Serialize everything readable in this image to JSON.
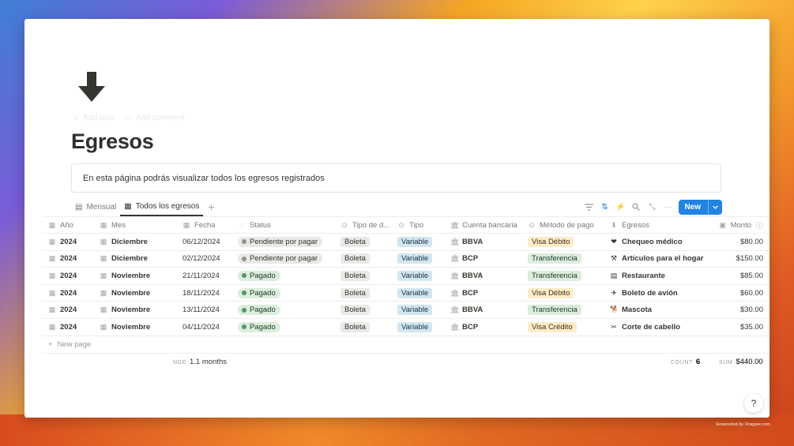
{
  "page": {
    "title": "Egresos",
    "ghost_add_icon": "Add icon",
    "ghost_add_comment": "Add comment",
    "callout": "En esta página podrás visualizar todos los egresos registrados"
  },
  "views": {
    "tabs": [
      {
        "label": "Mensual",
        "icon": "calendar-icon",
        "active": false
      },
      {
        "label": "Todos los egresos",
        "icon": "table-icon",
        "active": true
      }
    ],
    "new_label": "New"
  },
  "columns": [
    {
      "label": "Año",
      "icon": "calendar-icon"
    },
    {
      "label": "Mes",
      "icon": "calendar-icon"
    },
    {
      "label": "Fecha",
      "icon": "calendar-icon"
    },
    {
      "label": "Status",
      "icon": "status-icon"
    },
    {
      "label": "Tipo de d...",
      "icon": "select-icon"
    },
    {
      "label": "Tipo",
      "icon": "select-icon"
    },
    {
      "label": "Cuenta bancaria",
      "icon": "bank-icon"
    },
    {
      "label": "Método de pago",
      "icon": "select-icon"
    },
    {
      "label": "Egresos",
      "icon": "arrow-down-icon"
    },
    {
      "label": "Monto",
      "icon": "money-icon"
    }
  ],
  "rows": [
    {
      "year": "2024",
      "month": "Diciembre",
      "date": "06/12/2024",
      "status": "Pendiente por pagar",
      "status_kind": "pending",
      "doc": "Boleta",
      "type": "Variable",
      "bank": "BBVA",
      "method": "Visa Débito",
      "method_color": "orange",
      "expense": "Chequeo médico",
      "expense_icon": "heart-pulse-icon",
      "amount": "$80.00"
    },
    {
      "year": "2024",
      "month": "Diciembre",
      "date": "02/12/2024",
      "status": "Pendiente por pagar",
      "status_kind": "pending",
      "doc": "Boleta",
      "type": "Variable",
      "bank": "BCP",
      "method": "Transferencia",
      "method_color": "green",
      "expense": "Artículos para el hogar",
      "expense_icon": "hammer-icon",
      "amount": "$150.00"
    },
    {
      "year": "2024",
      "month": "Noviembre",
      "date": "21/11/2024",
      "status": "Pagado",
      "status_kind": "paid",
      "doc": "Boleta",
      "type": "Variable",
      "bank": "BBVA",
      "method": "Transferencia",
      "method_color": "green",
      "expense": "Restaurante",
      "expense_icon": "receipt-icon",
      "amount": "$85.00"
    },
    {
      "year": "2024",
      "month": "Noviembre",
      "date": "18/11/2024",
      "status": "Pagado",
      "status_kind": "paid",
      "doc": "Boleta",
      "type": "Variable",
      "bank": "BCP",
      "method": "Visa Débito",
      "method_color": "orange",
      "expense": "Boleto de avión",
      "expense_icon": "airplane-icon",
      "amount": "$60.00"
    },
    {
      "year": "2024",
      "month": "Noviembre",
      "date": "13/11/2024",
      "status": "Pagado",
      "status_kind": "paid",
      "doc": "Boleta",
      "type": "Variable",
      "bank": "BBVA",
      "method": "Transferencia",
      "method_color": "green",
      "expense": "Mascota",
      "expense_icon": "dog-icon",
      "amount": "$30.00"
    },
    {
      "year": "2024",
      "month": "Noviembre",
      "date": "04/11/2024",
      "status": "Pagado",
      "status_kind": "paid",
      "doc": "Boleta",
      "type": "Variable",
      "bank": "BCP",
      "method": "Visa Crédito",
      "method_color": "orange",
      "expense": "Corte de cabello",
      "expense_icon": "scissors-icon",
      "amount": "$35.00"
    }
  ],
  "new_page_label": "New page",
  "footer": {
    "range_label": "NGE",
    "range_value": "1.1 months",
    "count_label": "COUNT",
    "count_value": "6",
    "sum_label": "SUM",
    "sum_value": "$440.00"
  },
  "watermark": "Screenshot by Xnapper.com"
}
